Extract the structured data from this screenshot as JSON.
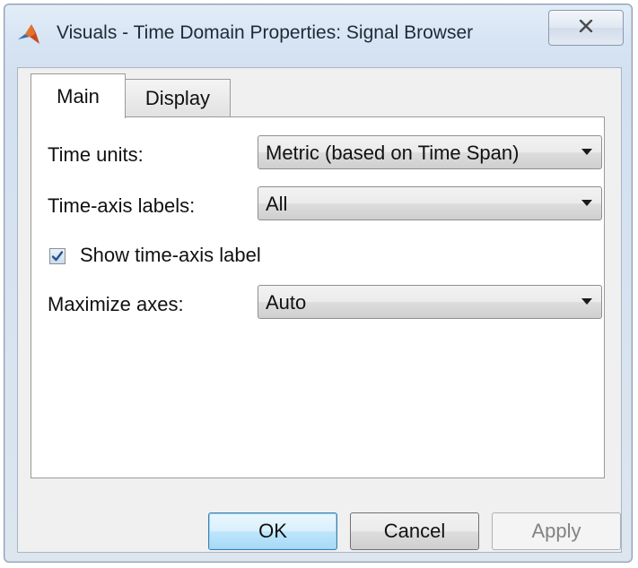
{
  "window": {
    "title": "Visuals - Time Domain Properties: Signal Browser",
    "app_icon": "matlab-membrane-icon",
    "close_icon": "close-icon"
  },
  "tabs": [
    {
      "label": "Main",
      "active": true
    },
    {
      "label": "Display",
      "active": false
    }
  ],
  "form": {
    "time_units": {
      "label": "Time units:",
      "value": "Metric (based on Time Span)"
    },
    "time_axis_labels": {
      "label": "Time-axis labels:",
      "value": "All"
    },
    "show_time_axis_label": {
      "label": "Show time-axis label",
      "checked": true
    },
    "maximize_axes": {
      "label": "Maximize axes:",
      "value": "Auto"
    }
  },
  "buttons": {
    "ok": "OK",
    "cancel": "Cancel",
    "apply": "Apply"
  },
  "colors": {
    "ok_accent": "#3c7fb1",
    "check_mark": "#2b4f86",
    "disabled_text": "#838383"
  }
}
